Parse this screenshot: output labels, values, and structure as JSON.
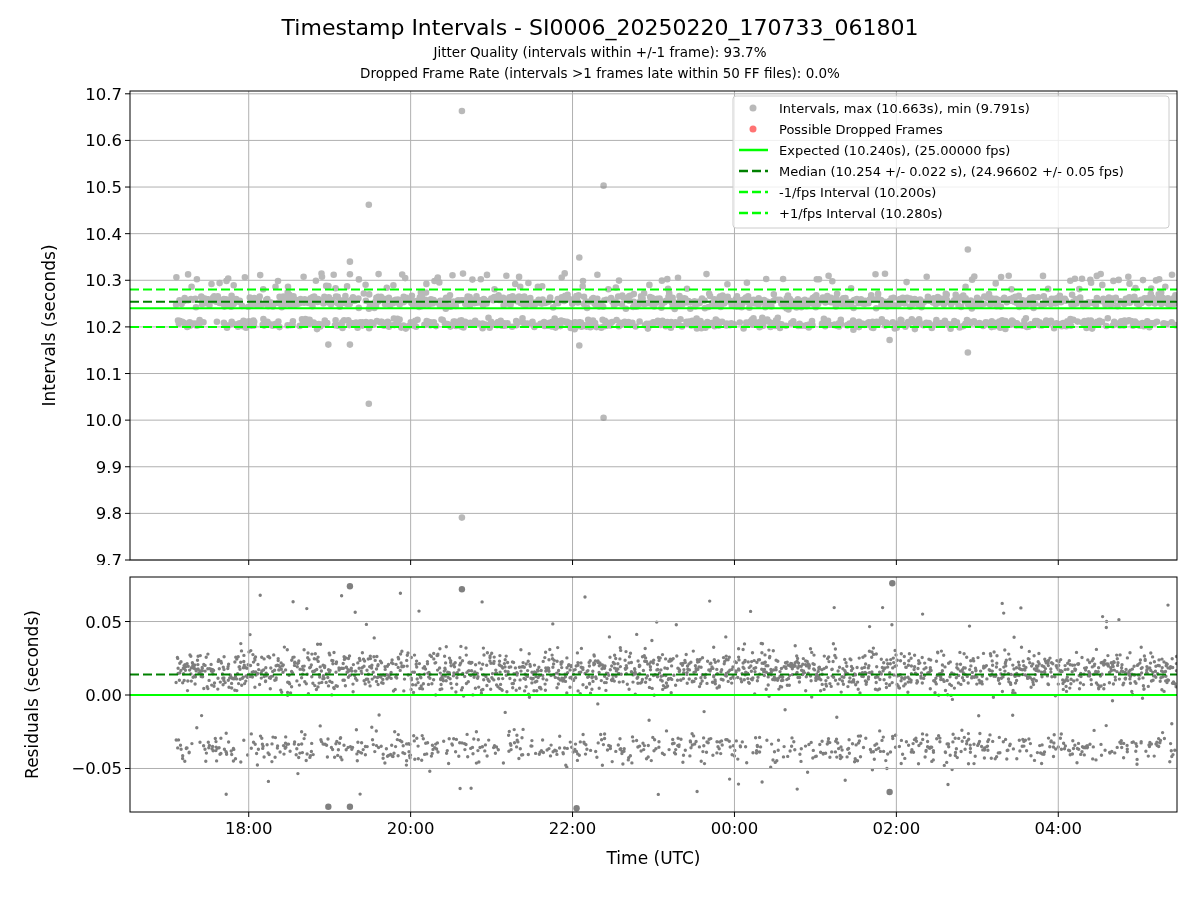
{
  "title": "Timestamp Intervals - SI0006_20250220_170733_061801",
  "subtitles": [
    "Jitter Quality (intervals within +/-1 frame): 93.7%",
    "Dropped Frame Rate (intervals >1 frames late within 50 FF files): 0.0%"
  ],
  "interval_panel": {
    "chart_data": {
      "type": "scatter",
      "ylabel": "Intervals (seconds)",
      "xlim": [
        "2025-02-20T16:32",
        "2025-02-21T05:28"
      ],
      "ylim": [
        9.7,
        10.706
      ],
      "yticks": [
        {
          "value": 9.7,
          "label": "9.7"
        },
        {
          "value": 9.8,
          "label": "9.8"
        },
        {
          "value": 9.9,
          "label": "9.9"
        },
        {
          "value": 10.0,
          "label": "10.0"
        },
        {
          "value": 10.1,
          "label": "10.1"
        },
        {
          "value": 10.2,
          "label": "10.2"
        },
        {
          "value": 10.3,
          "label": "10.3"
        },
        {
          "value": 10.4,
          "label": "10.4"
        },
        {
          "value": 10.5,
          "label": "10.5"
        },
        {
          "value": 10.6,
          "label": "10.6"
        },
        {
          "value": 10.7,
          "label": "10.7"
        }
      ],
      "x": [
        "2025-02-20T20:38",
        "2025-02-20T22:23",
        "2025-02-20T19:29",
        "2025-02-20T20:38",
        "2025-02-20T19:29",
        "2025-02-20T22:23",
        "2025-02-20T22:05",
        "2025-02-21T02:53",
        "2025-02-20T19:15",
        "2025-02-20T19:15",
        "2025-02-20T18:59",
        "2025-02-20T19:15",
        "2025-02-20T22:05",
        "2025-02-21T02:53",
        "2025-02-21T01:55"
      ],
      "series": [
        {
          "name": "Intervals, max (10.663s), min (9.791s)",
          "color": "#808080",
          "values": [
            10.663,
            10.503,
            10.462,
            9.791,
            10.035,
            10.005,
            10.349,
            10.366,
            10.34,
            10.313,
            10.162,
            10.162,
            10.16,
            10.145,
            10.172
          ]
        },
        {
          "name": "Possible Dropped Frames",
          "color": "#ff0000",
          "values": [
            null,
            null,
            null,
            null,
            null,
            null,
            null,
            null,
            null,
            null,
            null,
            null,
            null,
            null,
            null
          ]
        }
      ],
      "ref_lines": [
        {
          "label": "Expected (10.240s), (25.00000 fps)",
          "axis": "y",
          "value": 10.24,
          "color": "#00ff00"
        },
        {
          "label": "Median (10.254 +/- 0.022 s), (24.96602 +/- 0.05 fps)",
          "axis": "y",
          "value": 10.254,
          "color": "#008000"
        },
        {
          "label": "-1/fps Interval (10.200s)",
          "axis": "y",
          "value": 10.2,
          "color": "#00ff00"
        },
        {
          "label": "+1/fps Interval (10.280s)",
          "axis": "y",
          "value": 10.28,
          "color": "#00ff00"
        }
      ],
      "legend": true,
      "grid": true
    }
  },
  "residual_panel": {
    "chart_data": {
      "type": "scatter",
      "xlabel": "Time (UTC)",
      "ylabel": "Residuals (seconds)",
      "xlim": [
        "2025-02-20T16:32",
        "2025-02-21T05:28"
      ],
      "ylim": [
        -0.0796,
        0.0803
      ],
      "xticks": [
        {
          "value": "2025-02-20T18:00",
          "label": "18:00"
        },
        {
          "value": "2025-02-20T20:00",
          "label": "20:00"
        },
        {
          "value": "2025-02-20T22:00",
          "label": "22:00"
        },
        {
          "value": "2025-02-21T00:00",
          "label": "00:00"
        },
        {
          "value": "2025-02-21T02:00",
          "label": "02:00"
        },
        {
          "value": "2025-02-21T04:00",
          "label": "04:00"
        }
      ],
      "yticks": [
        {
          "value": -0.05,
          "label": "−0.05"
        },
        {
          "value": 0,
          "label": "0.00"
        },
        {
          "value": 0.05,
          "label": "0.05"
        }
      ],
      "x": [
        "2025-02-20T22:03",
        "2025-02-20T18:59",
        "2025-02-20T19:15",
        "2025-02-21T01:55",
        "2025-02-21T01:57",
        "2025-02-20T19:15",
        "2025-02-20T20:38"
      ],
      "series": [
        {
          "color": "#808080",
          "values": [
            -0.077,
            -0.076,
            -0.076,
            -0.066,
            0.076,
            0.074,
            0.072
          ]
        }
      ],
      "ref_lines": [
        {
          "axis": "y",
          "value": 0,
          "color": "#00ff00"
        },
        {
          "axis": "y",
          "value": 0.014,
          "color": "#008000"
        }
      ],
      "grid": true
    }
  }
}
